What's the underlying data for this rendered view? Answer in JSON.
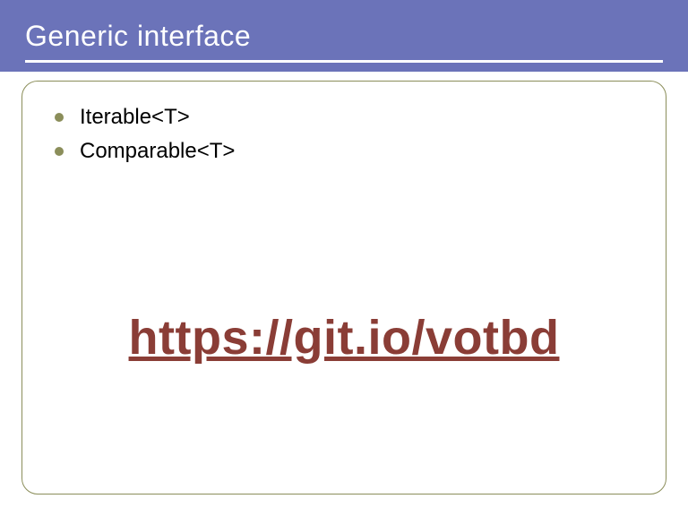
{
  "title": "Generic interface",
  "bullets": [
    {
      "label": "Iterable<T>"
    },
    {
      "label": "Comparable<T>"
    }
  ],
  "link": {
    "text": "https://git.io/votbd",
    "href": "https://git.io/votbd"
  }
}
